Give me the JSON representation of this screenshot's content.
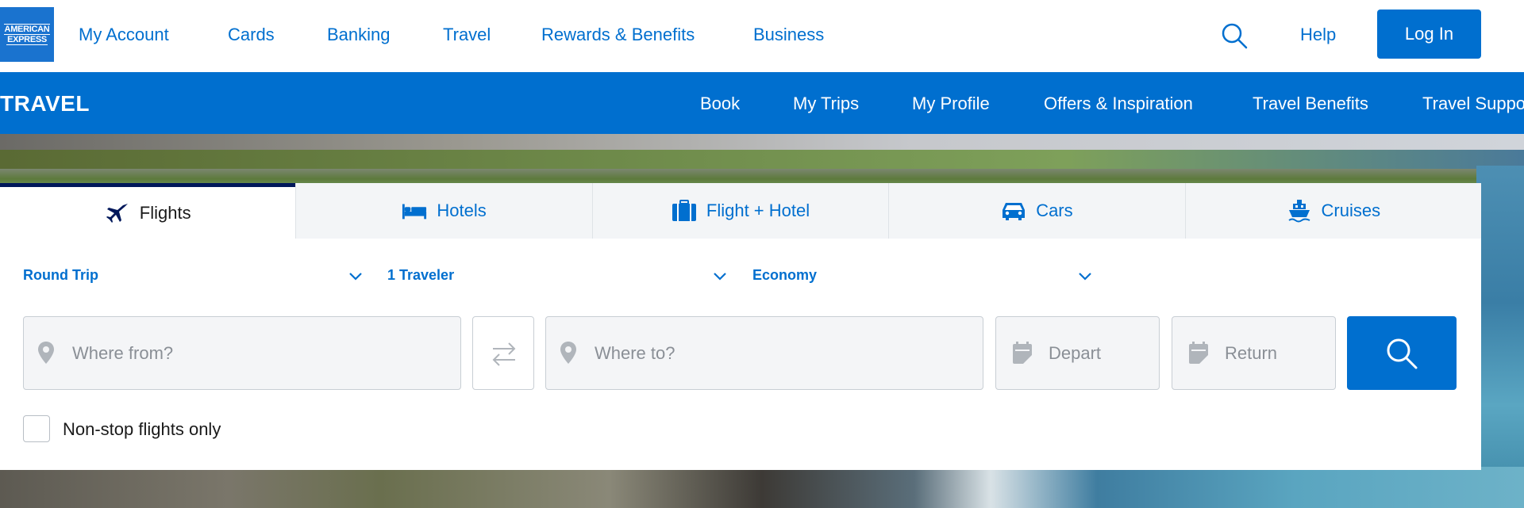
{
  "brand": {
    "logo_line1": "AMERICAN",
    "logo_line2": "EXPRESS",
    "accent": "#006fcf",
    "navy": "#00175a"
  },
  "topnav": {
    "links": [
      "My Account",
      "Cards",
      "Banking",
      "Travel",
      "Rewards & Benefits",
      "Business"
    ],
    "help": "Help",
    "login": "Log In",
    "search_icon": "search-icon"
  },
  "travelbar": {
    "brand": "TRAVEL",
    "links": [
      "Book",
      "My Trips",
      "My Profile",
      "Offers & Inspiration",
      "Travel Benefits",
      "Travel Suppo"
    ]
  },
  "tabs": [
    {
      "label": "Flights",
      "icon": "airplane-icon",
      "active": true
    },
    {
      "label": "Hotels",
      "icon": "bed-icon",
      "active": false
    },
    {
      "label": "Flight + Hotel",
      "icon": "luggage-icon",
      "active": false
    },
    {
      "label": "Cars",
      "icon": "car-icon",
      "active": false
    },
    {
      "label": "Cruises",
      "icon": "ship-icon",
      "active": false
    }
  ],
  "options": {
    "trip_type": "Round Trip",
    "travelers": "1 Traveler",
    "cabin": "Economy"
  },
  "fields": {
    "from_placeholder": "Where from?",
    "to_placeholder": "Where to?",
    "depart_placeholder": "Depart",
    "return_placeholder": "Return"
  },
  "nonstop_label": "Non-stop flights only"
}
